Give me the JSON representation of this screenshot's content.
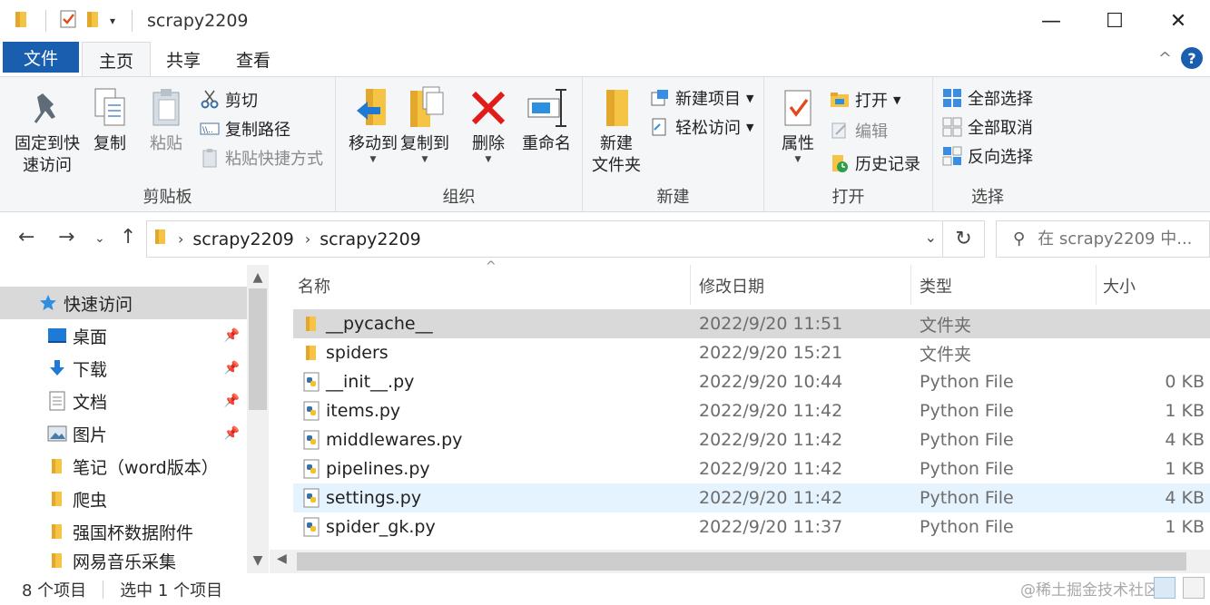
{
  "window": {
    "title": "scrapy2209",
    "minimize": "—",
    "maximize": "☐",
    "close": "✕"
  },
  "ribbon_tabs": {
    "file": "文件",
    "home": "主页",
    "share": "共享",
    "view": "查看",
    "collapse": "^",
    "help": "?"
  },
  "clipboard": {
    "pin_label": "固定到快速访问",
    "pin_line1": "固定到快",
    "pin_line2": "速访问",
    "copy": "复制",
    "paste": "粘贴",
    "cut": "剪切",
    "copy_path": "复制路径",
    "paste_shortcut": "粘贴快捷方式",
    "group": "剪贴板"
  },
  "organize": {
    "move_to": "移动到",
    "copy_to": "复制到",
    "delete": "删除",
    "rename": "重命名",
    "group": "组织"
  },
  "new": {
    "new_folder_line1": "新建",
    "new_folder_line2": "文件夹",
    "new_item": "新建项目",
    "easy_access": "轻松访问",
    "group": "新建"
  },
  "open": {
    "properties": "属性",
    "open": "打开",
    "edit": "编辑",
    "history": "历史记录",
    "group": "打开"
  },
  "select": {
    "select_all": "全部选择",
    "select_none": "全部取消",
    "invert": "反向选择",
    "group": "选择"
  },
  "address": {
    "crumbs": [
      "scrapy2209",
      "scrapy2209"
    ],
    "search_placeholder": "在 scrapy2209 中..."
  },
  "nav": {
    "items": [
      {
        "label": "快速访问",
        "pinned": false
      },
      {
        "label": "桌面",
        "pinned": true
      },
      {
        "label": "下载",
        "pinned": true
      },
      {
        "label": "文档",
        "pinned": true
      },
      {
        "label": "图片",
        "pinned": true
      },
      {
        "label": "笔记（word版本）",
        "pinned": false
      },
      {
        "label": "爬虫",
        "pinned": false
      },
      {
        "label": "强国杯数据附件",
        "pinned": false
      },
      {
        "label": "网易音乐采集",
        "pinned": false
      }
    ]
  },
  "columns": {
    "name": "名称",
    "date": "修改日期",
    "type": "类型",
    "size": "大小"
  },
  "files": [
    {
      "name": "__pycache__",
      "date": "2022/9/20 11:51",
      "type": "文件夹",
      "size": "",
      "kind": "folder"
    },
    {
      "name": "spiders",
      "date": "2022/9/20 15:21",
      "type": "文件夹",
      "size": "",
      "kind": "folder"
    },
    {
      "name": "__init__.py",
      "date": "2022/9/20 10:44",
      "type": "Python File",
      "size": "0 KB",
      "kind": "py"
    },
    {
      "name": "items.py",
      "date": "2022/9/20 11:42",
      "type": "Python File",
      "size": "1 KB",
      "kind": "py"
    },
    {
      "name": "middlewares.py",
      "date": "2022/9/20 11:42",
      "type": "Python File",
      "size": "4 KB",
      "kind": "py"
    },
    {
      "name": "pipelines.py",
      "date": "2022/9/20 11:42",
      "type": "Python File",
      "size": "1 KB",
      "kind": "py"
    },
    {
      "name": "settings.py",
      "date": "2022/9/20 11:42",
      "type": "Python File",
      "size": "4 KB",
      "kind": "py"
    },
    {
      "name": "spider_gk.py",
      "date": "2022/9/20 11:37",
      "type": "Python File",
      "size": "1 KB",
      "kind": "py"
    }
  ],
  "status": {
    "count": "8 个项目",
    "selected": "选中 1 个项目",
    "watermark": "@稀土掘金技术社区"
  },
  "colors": {
    "accent": "#1a5faf",
    "selected_row": "#d9d9d9",
    "hover_row": "#e5f3ff",
    "folder": "#f6c445"
  }
}
